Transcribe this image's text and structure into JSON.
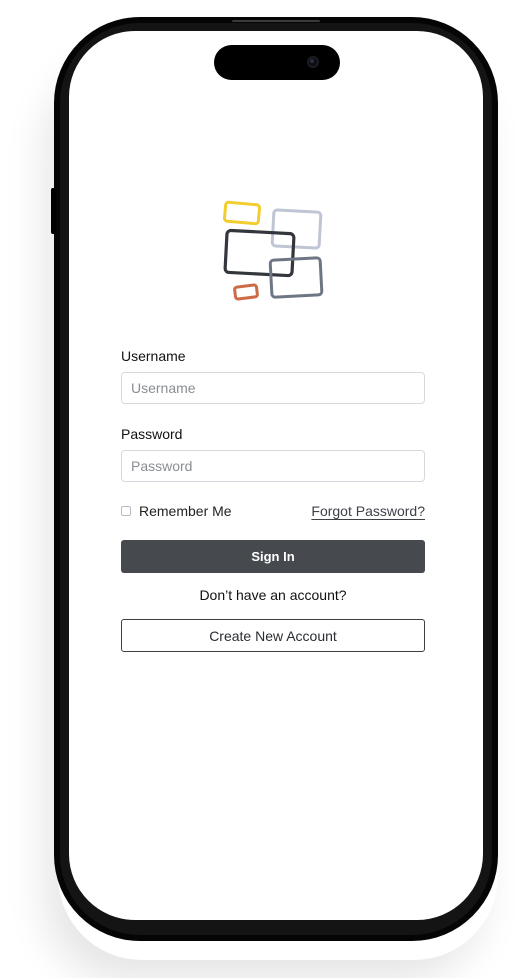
{
  "login": {
    "username_label": "Username",
    "username_placeholder": "Username",
    "username_value": "",
    "password_label": "Password",
    "password_placeholder": "Password",
    "password_value": "",
    "remember_me_label": "Remember Me",
    "remember_me_checked": false,
    "forgot_password_label": "Forgot Password?",
    "sign_in_label": "Sign In",
    "no_account_text": "Don’t have an account?",
    "create_account_label": "Create New Account"
  },
  "logo": {
    "icon": "overlapping-rectangles-logo",
    "colors": [
      "#f2cd2e",
      "#bfc5d4",
      "#33363c",
      "#6e7686",
      "#cc6b47"
    ]
  },
  "colors": {
    "primary_button": "#464a4f",
    "input_border": "#d6d8e0",
    "text": "#111111"
  }
}
